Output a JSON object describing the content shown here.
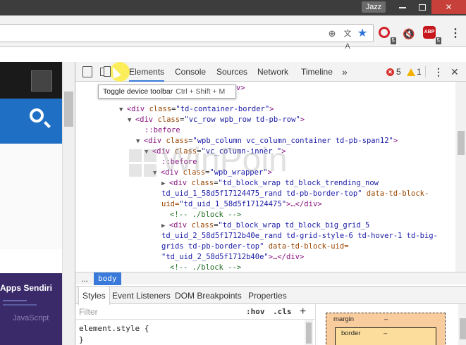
{
  "window": {
    "profile_name": "Jazz"
  },
  "toolbar": {
    "extensions": [
      {
        "name": "opera-turbo",
        "badge": "5"
      },
      {
        "name": "mute-tab",
        "badge": ""
      },
      {
        "name": "adblock-plus",
        "label": "ABP",
        "badge": "5"
      }
    ]
  },
  "page": {
    "apps_title": "Apps Sendiri",
    "apps_subtitle": "JavaScript"
  },
  "devtools": {
    "tabs": [
      {
        "label": "Elements",
        "active": true
      },
      {
        "label": "Console"
      },
      {
        "label": "Sources"
      },
      {
        "label": "Network"
      },
      {
        "label": "Timeline"
      }
    ],
    "more_label": "»",
    "error_count": "5",
    "warning_count": "1",
    "tooltip": {
      "title": "Toggle device toolbar",
      "shortcut": "Ctrl + Shift + M"
    },
    "tree_lines": [
      {
        "indent": 70,
        "prefix": "",
        "tag": "",
        "attrs": [],
        "text": "\"td-header-style-9\">…</div>",
        "kind": "code"
      },
      {
        "indent": 62,
        "prefix": "",
        "tag": "",
        "attrs": [],
        "text": "",
        "kind": "blank"
      },
      {
        "indent": 62,
        "prefix": "▼",
        "tag": "div",
        "attrs": [
          [
            "class",
            "td-container-border"
          ]
        ],
        "text": ">",
        "kind": "tag"
      },
      {
        "indent": 74,
        "prefix": "▼",
        "tag": "div",
        "attrs": [
          [
            "class",
            "vc_row wpb_row td-pb-row"
          ]
        ],
        "text": ">",
        "kind": "tag"
      },
      {
        "indent": 98,
        "prefix": "",
        "tag": "",
        "attrs": [],
        "text": "::before",
        "kind": "pseudo"
      },
      {
        "indent": 86,
        "prefix": "▼",
        "tag": "div",
        "attrs": [
          [
            "class",
            "wpb_column vc_column_container td-pb-span12"
          ]
        ],
        "text": ">",
        "kind": "tag"
      },
      {
        "indent": 98,
        "prefix": "▼",
        "tag": "div",
        "attrs": [
          [
            "class",
            "vc_column-inner "
          ]
        ],
        "text": ">",
        "kind": "tag"
      },
      {
        "indent": 122,
        "prefix": "",
        "tag": "",
        "attrs": [],
        "text": "::before",
        "kind": "pseudo"
      },
      {
        "indent": 110,
        "prefix": "▼",
        "tag": "div",
        "attrs": [
          [
            "class",
            "wpb_wrapper"
          ]
        ],
        "text": ">",
        "kind": "tag"
      },
      {
        "indent": 122,
        "prefix": "▶",
        "tag": "div",
        "attrs": [
          [
            "class",
            "td_block_wrap td_block_trending_now"
          ]
        ],
        "text": "",
        "kind": "tag-open"
      },
      {
        "indent": 122,
        "prefix": "",
        "tag": "",
        "attrs": [],
        "text": "td_uid_1_58d5f17124475_rand td-pb-border-top\"",
        "kind": "cont",
        "extra_attr": "data-td-block-"
      },
      {
        "indent": 122,
        "prefix": "",
        "tag": "",
        "attrs": [],
        "text": "uid=\"td_uid_1_58d5f17124475\">…</div>",
        "kind": "cont2"
      },
      {
        "indent": 134,
        "prefix": "",
        "tag": "",
        "attrs": [],
        "text": "<!-- ./block -->",
        "kind": "comment"
      },
      {
        "indent": 122,
        "prefix": "▶",
        "tag": "div",
        "attrs": [
          [
            "class",
            "td_block_wrap td_block_big_grid_5"
          ]
        ],
        "text": "",
        "kind": "tag-open"
      },
      {
        "indent": 122,
        "prefix": "",
        "tag": "",
        "attrs": [],
        "text": "td_uid_2_58d5f1712b40e_rand td-grid-style-6 td-hover-1 td-big-",
        "kind": "contval"
      },
      {
        "indent": 122,
        "prefix": "",
        "tag": "",
        "attrs": [],
        "text": "grids td-pb-border-top\"",
        "kind": "cont",
        "extra_attr": "data-td-block-uid="
      },
      {
        "indent": 122,
        "prefix": "",
        "tag": "",
        "attrs": [],
        "text": "\"td_uid_2_58d5f1712b40e\">…</div>",
        "kind": "cont3"
      },
      {
        "indent": 134,
        "prefix": "",
        "tag": "",
        "attrs": [],
        "text": "<!-- ./block -->",
        "kind": "comment"
      }
    ],
    "breadcrumb": {
      "ellipsis": "...",
      "current": "body"
    },
    "lower_tabs": [
      {
        "label": "Styles",
        "active": true
      },
      {
        "label": "Event Listeners"
      },
      {
        "label": "DOM Breakpoints"
      },
      {
        "label": "Properties"
      }
    ],
    "filter_placeholder": "Filter",
    "hov_label": ":hov",
    "cls_label": ".cls",
    "add_rule_label": "+",
    "element_style_open": "element.style {",
    "element_style_close": "}",
    "box_model": {
      "margin_label": "margin",
      "margin_value": "–",
      "border_label": "border",
      "border_value": "–"
    }
  },
  "colors": {
    "accent": "#3879d9",
    "close_button": "#c7403a",
    "page_search_band": "#1f6fc4",
    "error": "#d9302c",
    "warning": "#f2b200"
  },
  "watermark": "WinPoin"
}
